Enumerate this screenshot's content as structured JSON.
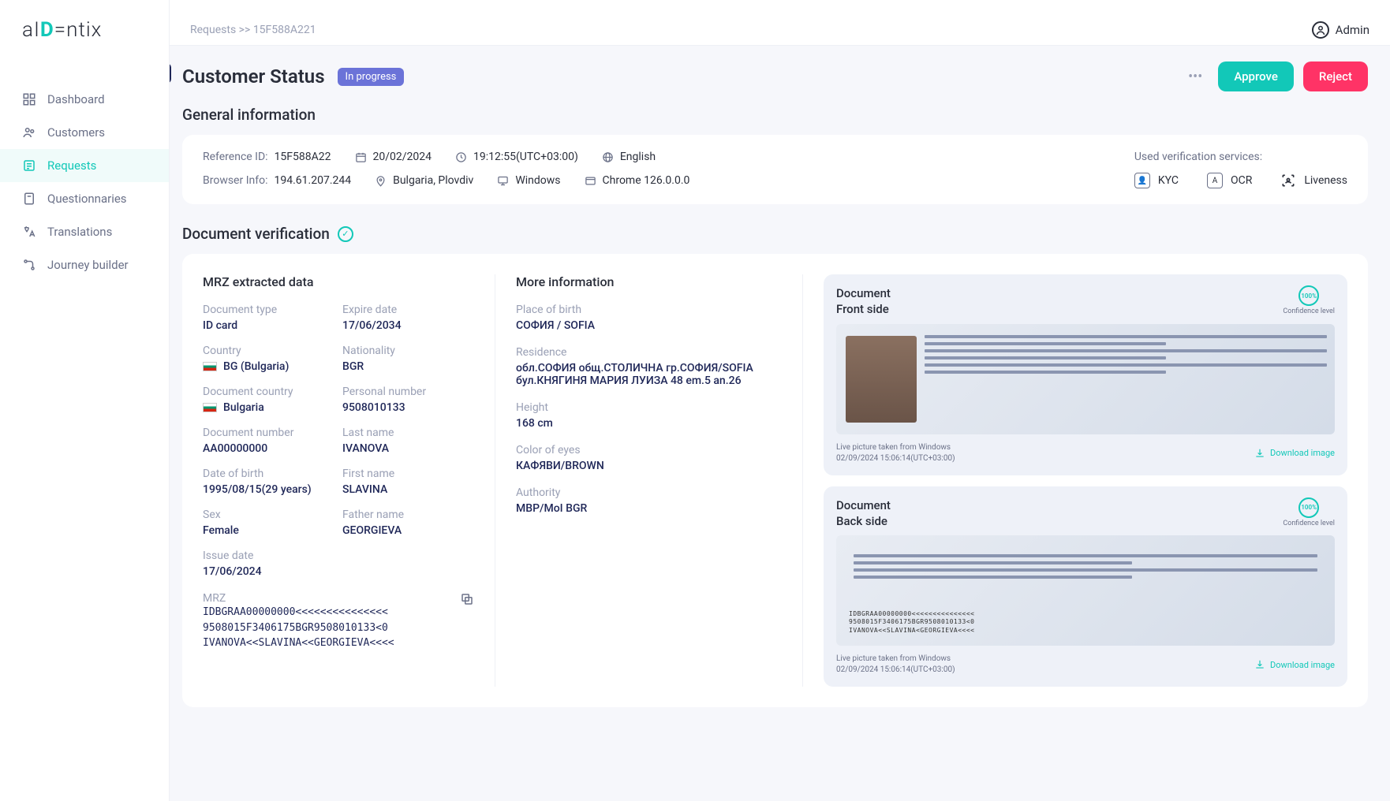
{
  "logo": {
    "part1": "aI",
    "part2": "D",
    "part3": "=ntix"
  },
  "sidebar": {
    "items": [
      {
        "label": "Dashboard",
        "icon": "dashboard-icon"
      },
      {
        "label": "Customers",
        "icon": "customers-icon"
      },
      {
        "label": "Requests",
        "icon": "requests-icon",
        "active": true
      },
      {
        "label": "Questionnaries",
        "icon": "questionnaires-icon"
      },
      {
        "label": "Translations",
        "icon": "translations-icon"
      },
      {
        "label": "Journey builder",
        "icon": "journey-icon"
      }
    ]
  },
  "breadcrumb": {
    "root": "Requests",
    "sep": ">>",
    "id": "15F588A221"
  },
  "admin_label": "Admin",
  "header": {
    "title": "Customer Status",
    "status": "In progress",
    "approve": "Approve",
    "reject": "Reject"
  },
  "sections": {
    "general": "General information",
    "docverif": "Document verification"
  },
  "general": {
    "ref_label": "Reference ID:",
    "ref_val": "15F588A22",
    "date": "20/02/2024",
    "time": "19:12:55(UTC+03:00)",
    "language": "English",
    "browser_label": "Browser Info:",
    "ip": "194.61.207.244",
    "location": "Bulgaria, Plovdiv",
    "os": "Windows",
    "browser": "Chrome 126.0.0.0",
    "services_label": "Used verification services:",
    "services": [
      "KYC",
      "OCR",
      "Liveness"
    ]
  },
  "mrz": {
    "head": "MRZ extracted data",
    "doc_type_l": "Document type",
    "doc_type_v": "ID card",
    "expire_l": "Expire date",
    "expire_v": "17/06/2034",
    "country_l": "Country",
    "country_v": "BG (Bulgaria)",
    "nat_l": "Nationality",
    "nat_v": "BGR",
    "doccountry_l": "Document country",
    "doccountry_v": "Bulgaria",
    "personal_l": "Personal number",
    "personal_v": "9508010133",
    "docnum_l": "Document number",
    "docnum_v": "AA00000000",
    "last_l": "Last name",
    "last_v": "IVANOVA",
    "dob_l": "Date of birth",
    "dob_v": "1995/08/15(29 years)",
    "first_l": "First name",
    "first_v": "SLAVINA",
    "sex_l": "Sex",
    "sex_v": "Female",
    "father_l": "Father name",
    "father_v": "GEORGIEVA",
    "issue_l": "Issue date",
    "issue_v": "17/06/2024",
    "mrz_l": "MRZ",
    "mrz_v": "IDBGRAA00000000<<<<<<<<<<<<<<<\n9508015F3406175BGR9508010133<0\nIVANOVA<<SLAVINA<<GEORGIEVA<<<<"
  },
  "more": {
    "head": "More information",
    "pob_l": "Place of birth",
    "pob_v": "СОФИЯ / SOFIA",
    "res_l": "Residence",
    "res_v": "обл.СОФИЯ общ.СТОЛИЧНА гр.СОФИЯ/SOFIA бул.КНЯГИНЯ МАРИЯ ЛУИЗА 48 em.5 an.26",
    "h_l": "Height",
    "h_v": "168 cm",
    "eyes_l": "Color of eyes",
    "eyes_v": "КАФЯВИ/BROWN",
    "auth_l": "Authority",
    "auth_v": "МВР/MoI BGR"
  },
  "docimg": {
    "front_t": "Document\nFront side",
    "back_t": "Document\nBack side",
    "conf": "100%",
    "conf_label": "Confidence level",
    "ts_line1": "Live picture taken from Windows",
    "ts_line2": "02/09/2024 15:06:14(UTC+03:00)",
    "download": "Download image"
  }
}
